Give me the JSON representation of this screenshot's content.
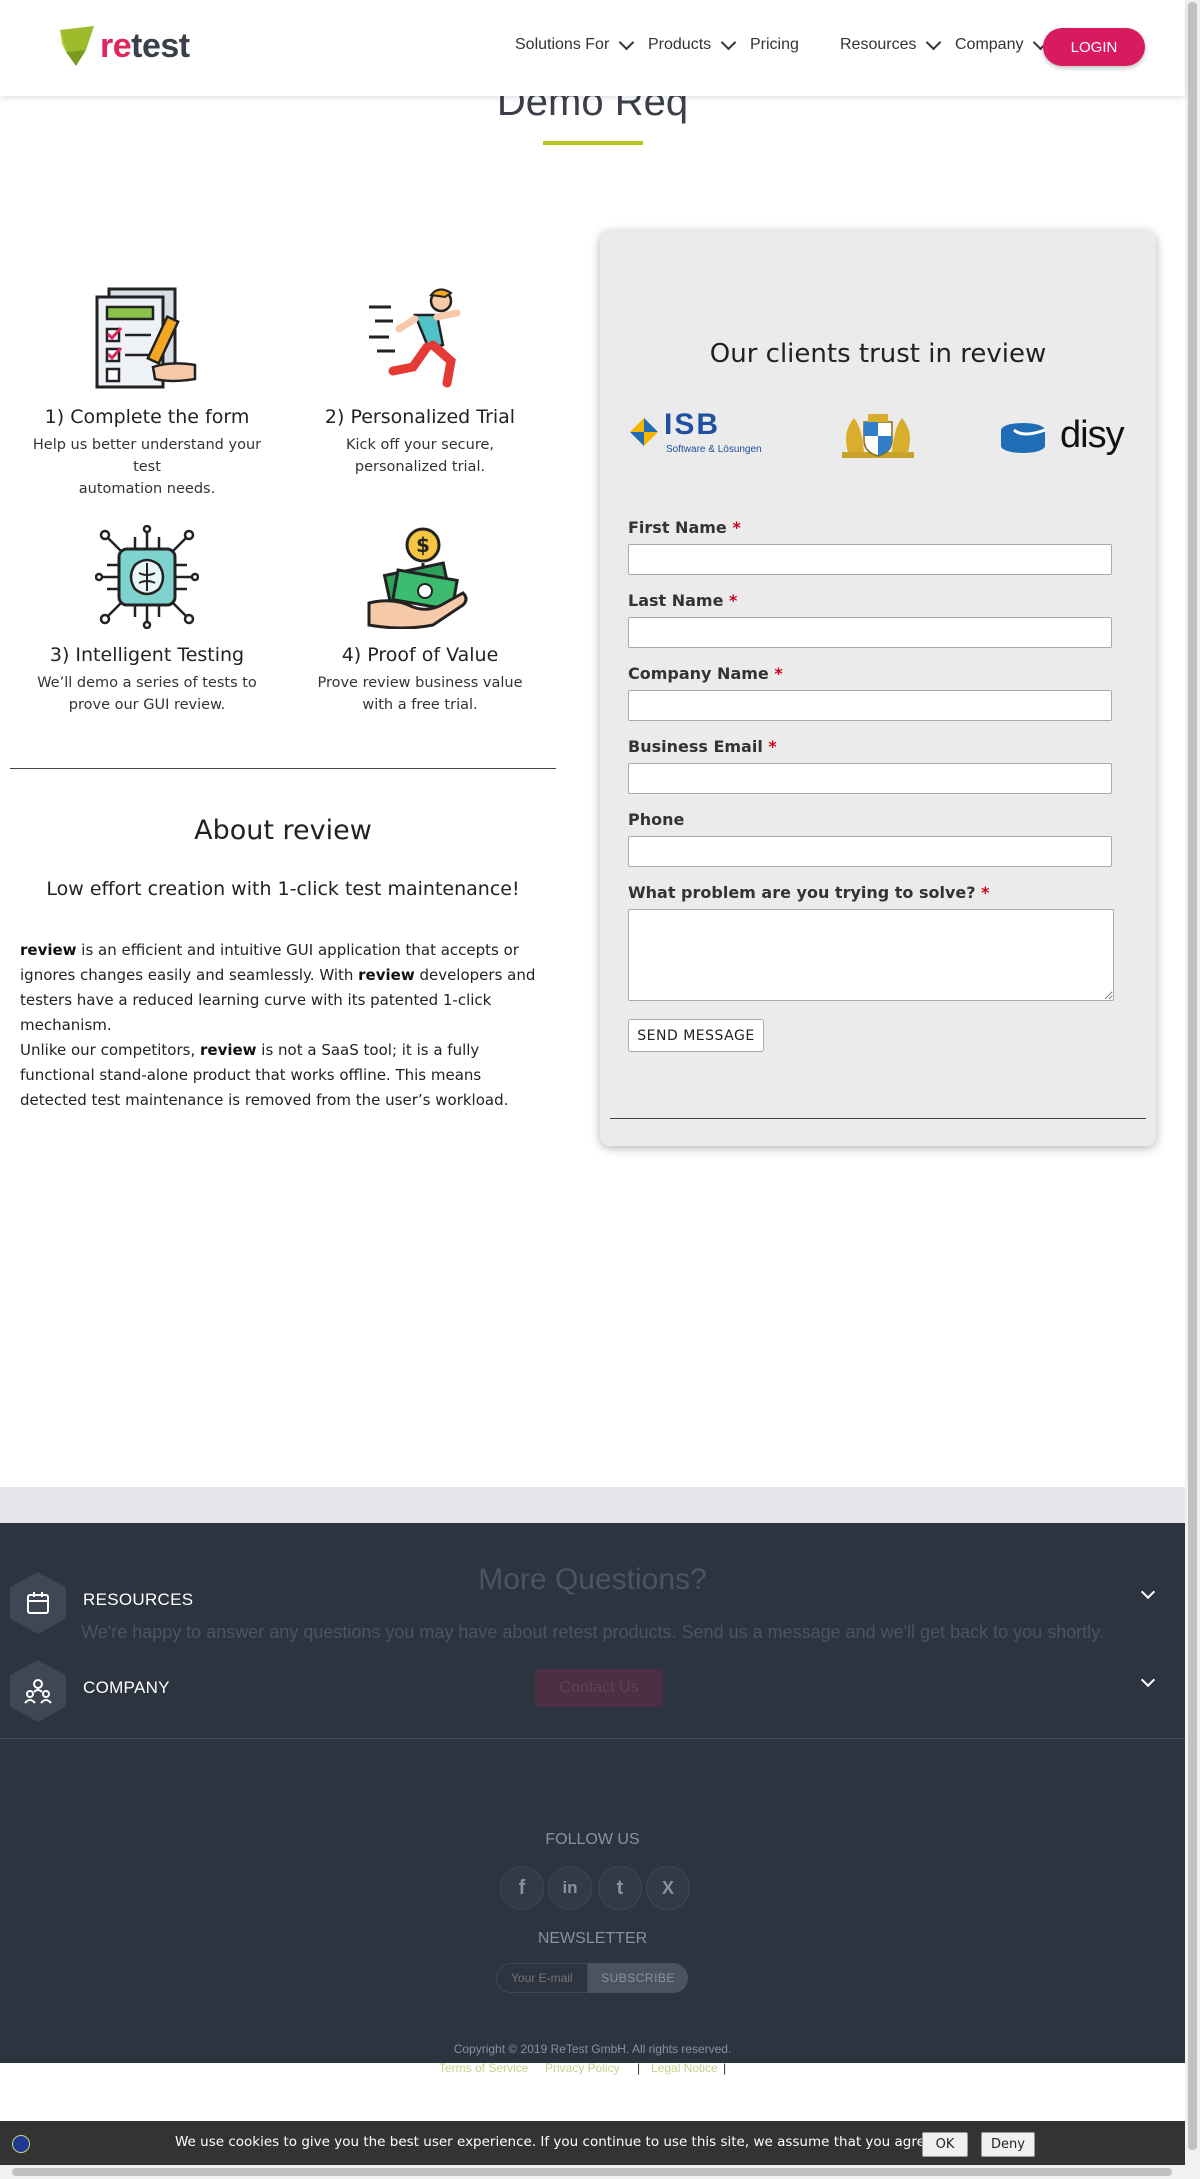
{
  "header": {
    "logo_text": "retest",
    "logo_highlight": "re",
    "logo_rest": "test",
    "nav": [
      {
        "label": "Solutions For",
        "dropdown": true
      },
      {
        "label": "Products",
        "dropdown": true
      },
      {
        "label": "Pricing",
        "dropdown": false
      },
      {
        "label": "Resources",
        "dropdown": true
      },
      {
        "label": "Company",
        "dropdown": true
      }
    ],
    "login_label": "LOGIN"
  },
  "page": {
    "title": "Demo Req"
  },
  "steps": [
    {
      "title": "1) Complete the form",
      "desc_line1": "Help us better understand your test",
      "desc_line2": "automation needs.",
      "icon": "form-checklist-icon"
    },
    {
      "title": "2) Personalized Trial",
      "desc_line1": "Kick off your secure,",
      "desc_line2": "personalized trial.",
      "icon": "running-person-icon"
    },
    {
      "title": "3) Intelligent Testing",
      "desc_line1": "We’ll demo a series of tests to",
      "desc_line2": "prove our GUI review.",
      "icon": "brain-chip-icon"
    },
    {
      "title": "4) Proof of Value",
      "desc_line1": "Prove review business value",
      "desc_line2": "with a free trial.",
      "icon": "money-hand-icon"
    }
  ],
  "about": {
    "title": "About review",
    "subtitle": "Low effort creation with 1-click test maintenance!",
    "brand": "review",
    "p1_a": " is an efficient and intuitive GUI application that accepts or ignores changes easily and seamlessly. With ",
    "p1_b": " developers and testers have a reduced learning curve with its patented 1-click mechanism.",
    "p2_a": "Unlike our competitors, ",
    "p2_b": " is not a SaaS tool; it is a fully functional stand-alone product that works offline. This means detected test maintenance is removed from the user’s workload."
  },
  "form": {
    "clients_title": "Our clients trust in review",
    "clients": [
      {
        "name": "ISB",
        "sub": "Software & Lösungen"
      },
      {
        "name": "Bavarian coat of arms"
      },
      {
        "name": "disy"
      }
    ],
    "fields": [
      {
        "label": "First Name",
        "required": true,
        "value": ""
      },
      {
        "label": "Last Name",
        "required": true,
        "value": ""
      },
      {
        "label": "Company Name",
        "required": true,
        "value": ""
      },
      {
        "label": "Business Email",
        "required": true,
        "value": ""
      },
      {
        "label": "Phone",
        "required": false,
        "value": ""
      },
      {
        "label": "What problem are you trying to solve?",
        "required": true,
        "value": ""
      }
    ],
    "required_mark": "*",
    "submit_label": "SEND MESSAGE"
  },
  "footer": {
    "cta_title": "More Questions?",
    "cta_text": "We're happy to answer any questions you may have about retest products. Send us a message and we'll get back to you shortly.",
    "cta_button": "Contact Us",
    "accordion": [
      {
        "label": "RESOURCES",
        "icon": "calendar-box-icon"
      },
      {
        "label": "COMPANY",
        "icon": "team-icon"
      }
    ],
    "follow_title": "FOLLOW US",
    "social": [
      {
        "name": "facebook-icon",
        "glyph": "f"
      },
      {
        "name": "linkedin-icon",
        "glyph": "in"
      },
      {
        "name": "twitter-icon",
        "glyph": "t"
      },
      {
        "name": "xing-icon",
        "glyph": "X"
      }
    ],
    "newsletter_title": "NEWSLETTER",
    "newsletter_placeholder": "Your E-mail",
    "subscribe_label": "SUBSCRIBE",
    "copyright": "Copyright © 2019 ReTest GmbH. All rights reserved.",
    "links": [
      "Terms of Service",
      "Privacy Policy",
      "Legal Notice"
    ],
    "separator": "|"
  },
  "cookie": {
    "text": "We use cookies to give you the best user experience. If you continue to use this site, we assume that you agree.",
    "ok": "OK",
    "deny": "Deny"
  },
  "colors": {
    "accent": "#d81b60",
    "lime": "#b5c41e",
    "footer": "#2c3440"
  }
}
